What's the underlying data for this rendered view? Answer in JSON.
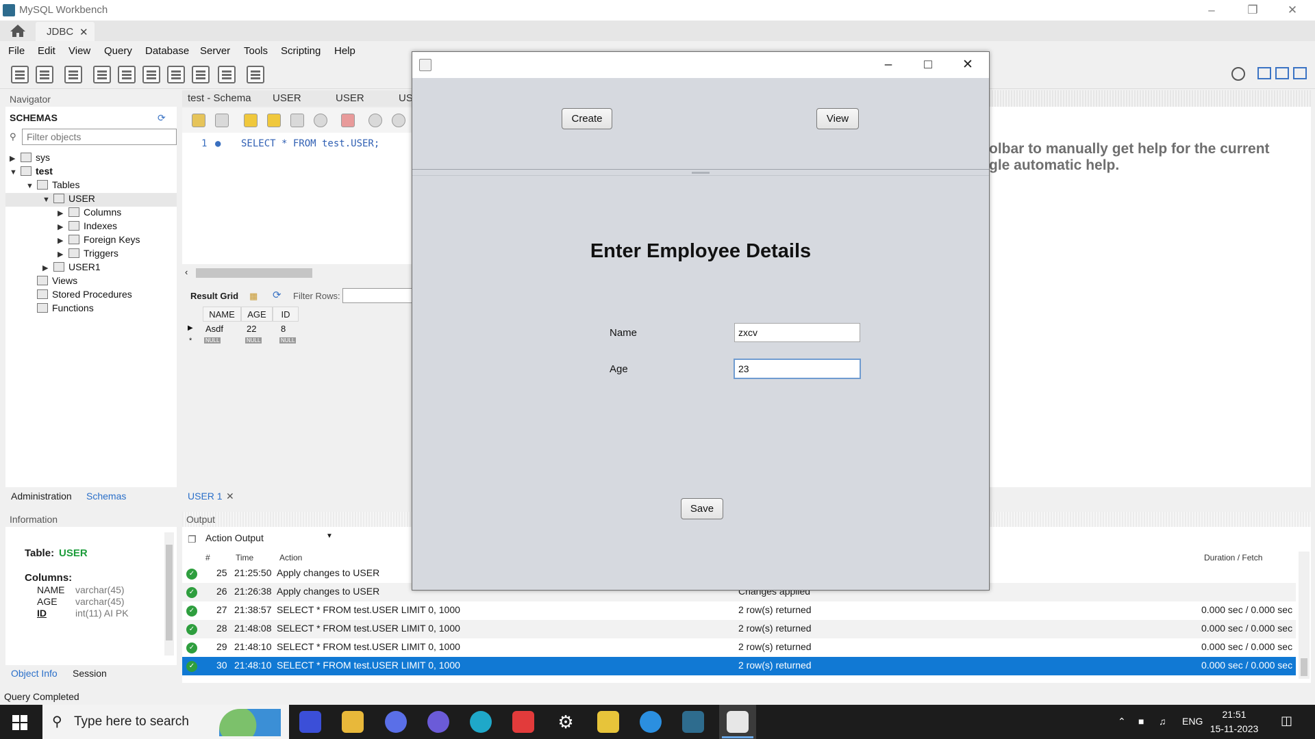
{
  "window": {
    "title": "MySQL Workbench"
  },
  "tabs": {
    "home": "home-icon",
    "connection": "JDBC"
  },
  "menu": [
    "File",
    "Edit",
    "View",
    "Query",
    "Database",
    "Server",
    "Tools",
    "Scripting",
    "Help"
  ],
  "navigator": {
    "title": "Navigator",
    "section": "SCHEMAS",
    "filter_placeholder": "Filter objects",
    "tree": {
      "sys": "sys",
      "test": "test",
      "tables": "Tables",
      "user": "USER",
      "columns": "Columns",
      "indexes": "Indexes",
      "foreign_keys": "Foreign Keys",
      "triggers": "Triggers",
      "user1": "USER1",
      "views": "Views",
      "stored_procedures": "Stored Procedures",
      "functions": "Functions"
    },
    "bottom_tabs": [
      "Administration",
      "Schemas"
    ]
  },
  "editor": {
    "tabs": [
      "test - Schema",
      "USER",
      "USER",
      "US"
    ],
    "line_number": "1",
    "sql": "SELECT * FROM test.USER;"
  },
  "result": {
    "title": "Result Grid",
    "filter_label": "Filter Rows:",
    "columns": [
      "NAME",
      "AGE",
      "ID"
    ],
    "row": [
      "Asdf",
      "22",
      "8"
    ],
    "null_label": "NULL",
    "tab": "USER 1"
  },
  "help_text": [
    "olbar to manually get help for the current",
    "gle automatic help."
  ],
  "information": {
    "title": "Information",
    "table_label": "Table:",
    "table_name": "USER",
    "columns_label": "Columns:",
    "columns": [
      {
        "name": "NAME",
        "type": "varchar(45)"
      },
      {
        "name": "AGE",
        "type": "varchar(45)"
      },
      {
        "name": "ID",
        "type": "int(11) AI PK"
      }
    ],
    "tabs": [
      "Object Info",
      "Session"
    ]
  },
  "output": {
    "title": "Output",
    "selector": "Action Output",
    "headers": {
      "num": "#",
      "time": "Time",
      "action": "Action",
      "duration": "Duration / Fetch"
    },
    "rows": [
      {
        "num": "25",
        "time": "21:25:50",
        "action": "Apply changes to USER",
        "message": "",
        "duration": ""
      },
      {
        "num": "26",
        "time": "21:26:38",
        "action": "Apply changes to USER",
        "message": "Changes applied",
        "duration": ""
      },
      {
        "num": "27",
        "time": "21:38:57",
        "action": "SELECT * FROM test.USER LIMIT 0, 1000",
        "message": "2 row(s) returned",
        "duration": "0.000 sec / 0.000 sec"
      },
      {
        "num": "28",
        "time": "21:48:08",
        "action": "SELECT * FROM test.USER LIMIT 0, 1000",
        "message": "2 row(s) returned",
        "duration": "0.000 sec / 0.000 sec"
      },
      {
        "num": "29",
        "time": "21:48:10",
        "action": "SELECT * FROM test.USER LIMIT 0, 1000",
        "message": "2 row(s) returned",
        "duration": "0.000 sec / 0.000 sec"
      },
      {
        "num": "30",
        "time": "21:48:10",
        "action": "SELECT * FROM test.USER LIMIT 0, 1000",
        "message": "2 row(s) returned",
        "duration": "0.000 sec / 0.000 sec"
      }
    ]
  },
  "status": "Query Completed",
  "dialog": {
    "create_label": "Create",
    "view_label": "View",
    "heading": "Enter Employee Details",
    "name_label": "Name",
    "name_value": "zxcv",
    "age_label": "Age",
    "age_value": "23",
    "save_label": "Save"
  },
  "taskbar": {
    "search_placeholder": "Type here to search",
    "language": "ENG",
    "time": "21:51",
    "date": "15-11-2023"
  },
  "colors": {
    "selection": "#1179d4",
    "ok": "#2e9e3e",
    "link": "#2a6fc9",
    "table_name": "#1c9c3a"
  }
}
